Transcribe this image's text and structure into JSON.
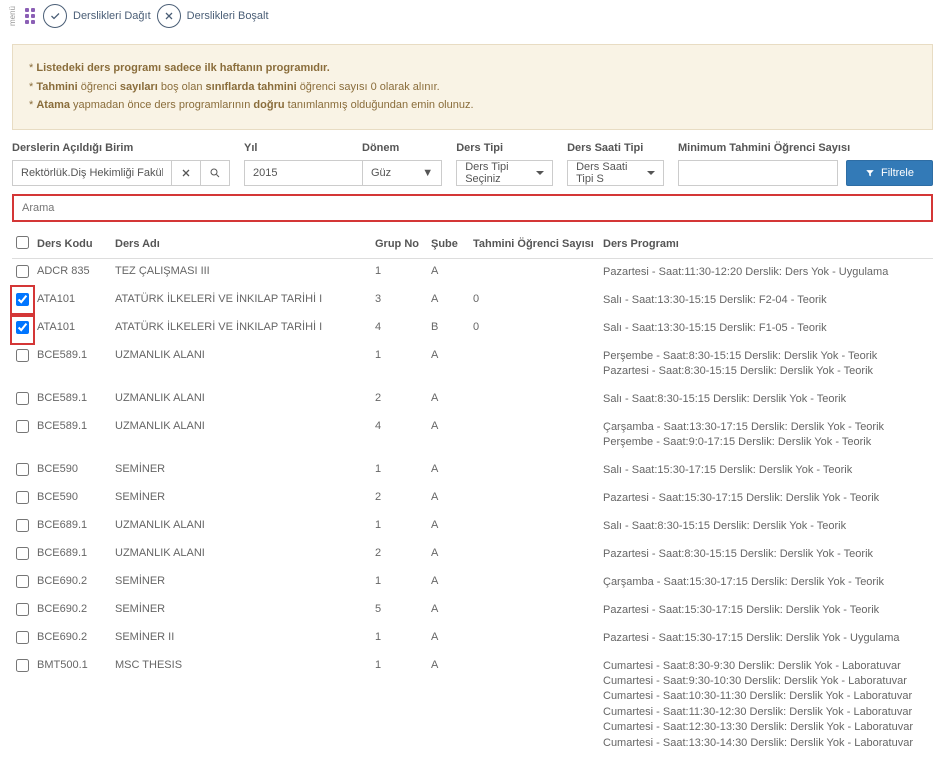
{
  "topbar": {
    "menu_label": "menü",
    "distribute_label": "Derslikleri Dağıt",
    "empty_label": "Derslikleri Boşalt"
  },
  "warnings": {
    "line1_pre": "* ",
    "line1_b1": "Listedeki ders programı sadece ",
    "line1_b2": "ilk haftanın programıdır.",
    "line2_pre": "* ",
    "line2_b1": "Tahmini ",
    "line2_t1": "öğrenci ",
    "line2_b2": "sayıları ",
    "line2_t2": "boş olan ",
    "line2_b3": "sınıflarda tahmini ",
    "line2_t3": "öğrenci sayısı 0 olarak alınır.",
    "line3_pre": "* ",
    "line3_b1": "Atama ",
    "line3_t1": "yapmadan önce ders programlarının ",
    "line3_b2": "doğru ",
    "line3_t2": "tanımlanmış olduğundan emin olunuz."
  },
  "filters": {
    "birim_label": "Derslerin Açıldığı Birim",
    "birim_value": "Rektörlük.Diş Hekimliği Fakültesi.",
    "yil_label": "Yıl",
    "yil_value": "2015",
    "donem_label": "Dönem",
    "donem_value": "Güz",
    "derstipi_label": "Ders Tipi",
    "derstipi_value": "Ders Tipi Seçiniz",
    "saattipi_label": "Ders Saati Tipi",
    "saattipi_value": "Ders Saati Tipi S",
    "min_label": "Minimum Tahmini Öğrenci Sayısı",
    "filter_btn": "Filtrele"
  },
  "search": {
    "placeholder": "Arama"
  },
  "table": {
    "headers": {
      "code": "Ders Kodu",
      "name": "Ders Adı",
      "grup": "Grup No",
      "sube": "Şube",
      "tahmin": "Tahmini Öğrenci Sayısı",
      "program": "Ders Programı"
    },
    "rows": [
      {
        "checked": false,
        "highlight": false,
        "code": "ADCR 835",
        "name": "TEZ ÇALIŞMASI III",
        "grup": "1",
        "sube": "A",
        "tahmin": "",
        "program": [
          "Pazartesi - Saat:11:30-12:20 Derslik: Ders Yok - Uygulama"
        ]
      },
      {
        "checked": true,
        "highlight": true,
        "code": "ATA101",
        "name": "ATATÜRK İLKELERİ VE İNKILAP TARİHİ I",
        "grup": "3",
        "sube": "A",
        "tahmin": "0",
        "program": [
          "Salı - Saat:13:30-15:15 Derslik: F2-04 - Teorik"
        ]
      },
      {
        "checked": true,
        "highlight": true,
        "code": "ATA101",
        "name": "ATATÜRK İLKELERİ VE İNKILAP TARİHİ I",
        "grup": "4",
        "sube": "B",
        "tahmin": "0",
        "program": [
          "Salı - Saat:13:30-15:15 Derslik: F1-05 - Teorik"
        ]
      },
      {
        "checked": false,
        "highlight": false,
        "code": "BCE589.1",
        "name": "UZMANLIK ALANI",
        "grup": "1",
        "sube": "A",
        "tahmin": "",
        "program": [
          "Perşembe - Saat:8:30-15:15 Derslik: Derslik Yok - Teorik",
          "Pazartesi - Saat:8:30-15:15 Derslik: Derslik Yok - Teorik"
        ]
      },
      {
        "checked": false,
        "highlight": false,
        "code": "BCE589.1",
        "name": "UZMANLIK ALANI",
        "grup": "2",
        "sube": "A",
        "tahmin": "",
        "program": [
          "Salı - Saat:8:30-15:15 Derslik: Derslik Yok - Teorik"
        ]
      },
      {
        "checked": false,
        "highlight": false,
        "code": "BCE589.1",
        "name": "UZMANLIK ALANI",
        "grup": "4",
        "sube": "A",
        "tahmin": "",
        "program": [
          "Çarşamba - Saat:13:30-17:15 Derslik: Derslik Yok - Teorik",
          "Perşembe - Saat:9:0-17:15 Derslik: Derslik Yok - Teorik"
        ]
      },
      {
        "checked": false,
        "highlight": false,
        "code": "BCE590",
        "name": "SEMİNER",
        "grup": "1",
        "sube": "A",
        "tahmin": "",
        "program": [
          "Salı - Saat:15:30-17:15 Derslik: Derslik Yok - Teorik"
        ]
      },
      {
        "checked": false,
        "highlight": false,
        "code": "BCE590",
        "name": "SEMİNER",
        "grup": "2",
        "sube": "A",
        "tahmin": "",
        "program": [
          "Pazartesi - Saat:15:30-17:15 Derslik: Derslik Yok - Teorik"
        ]
      },
      {
        "checked": false,
        "highlight": false,
        "code": "BCE689.1",
        "name": "UZMANLIK ALANI",
        "grup": "1",
        "sube": "A",
        "tahmin": "",
        "program": [
          "Salı - Saat:8:30-15:15 Derslik: Derslik Yok - Teorik"
        ]
      },
      {
        "checked": false,
        "highlight": false,
        "code": "BCE689.1",
        "name": "UZMANLIK ALANI",
        "grup": "2",
        "sube": "A",
        "tahmin": "",
        "program": [
          "Pazartesi - Saat:8:30-15:15 Derslik: Derslik Yok - Teorik"
        ]
      },
      {
        "checked": false,
        "highlight": false,
        "code": "BCE690.2",
        "name": "SEMİNER",
        "grup": "1",
        "sube": "A",
        "tahmin": "",
        "program": [
          "Çarşamba - Saat:15:30-17:15 Derslik: Derslik Yok - Teorik"
        ]
      },
      {
        "checked": false,
        "highlight": false,
        "code": "BCE690.2",
        "name": "SEMİNER",
        "grup": "5",
        "sube": "A",
        "tahmin": "",
        "program": [
          "Pazartesi - Saat:15:30-17:15 Derslik: Derslik Yok - Teorik"
        ]
      },
      {
        "checked": false,
        "highlight": false,
        "code": "BCE690.2",
        "name": "SEMİNER II",
        "grup": "1",
        "sube": "A",
        "tahmin": "",
        "program": [
          "Pazartesi - Saat:15:30-17:15 Derslik: Derslik Yok - Uygulama"
        ]
      },
      {
        "checked": false,
        "highlight": false,
        "code": "BMT500.1",
        "name": "MSC THESIS",
        "grup": "1",
        "sube": "A",
        "tahmin": "",
        "program": [
          "Cumartesi - Saat:8:30-9:30 Derslik: Derslik Yok - Laboratuvar",
          "Cumartesi - Saat:9:30-10:30 Derslik: Derslik Yok - Laboratuvar",
          "Cumartesi - Saat:10:30-11:30 Derslik: Derslik Yok - Laboratuvar",
          "Cumartesi - Saat:11:30-12:30 Derslik: Derslik Yok - Laboratuvar",
          "Cumartesi - Saat:12:30-13:30 Derslik: Derslik Yok - Laboratuvar",
          "Cumartesi - Saat:13:30-14:30 Derslik: Derslik Yok - Laboratuvar"
        ]
      }
    ]
  }
}
